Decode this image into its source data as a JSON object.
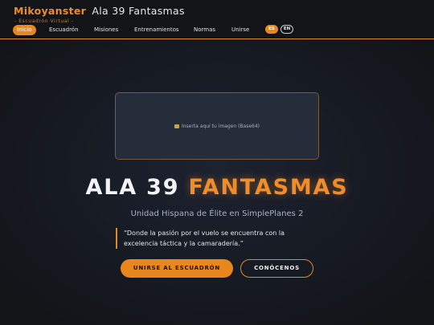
{
  "header": {
    "brand_name": "Mikoyanster",
    "brand_title": "Ala 39 Fantasmas",
    "subtitle": "- Escuadrón Virtual -",
    "nav": [
      {
        "label": "Inicio",
        "active": true
      },
      {
        "label": "Escuadrón",
        "active": false
      },
      {
        "label": "Misiones",
        "active": false
      },
      {
        "label": "Entrenamientos",
        "active": false
      },
      {
        "label": "Normas",
        "active": false
      },
      {
        "label": "Unirse",
        "active": false
      }
    ],
    "languages": [
      {
        "label": "ES",
        "active": true
      },
      {
        "label": "EN",
        "active": false
      }
    ]
  },
  "hero": {
    "image_placeholder": "Inserta aquí tu imagen (Base64)",
    "image_icon": "image-icon",
    "title_white": "ALA 39",
    "title_orange": "FANTASMAS",
    "tagline": "Unidad Hispana de Élite en SimplePlanes 2",
    "quote": "“Donde la pasión por el vuelo se encuentra con la excelencia táctica y la camaradería.”",
    "primary_button": "UNIRSE AL ESCUADRÓN",
    "secondary_button": "CONÓCENOS"
  },
  "colors": {
    "accent": "#e8871e",
    "background": "#14171d",
    "header_bg": "#121418"
  }
}
